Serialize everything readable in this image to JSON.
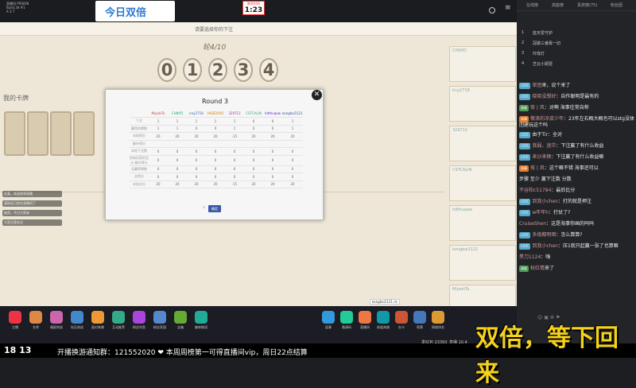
{
  "stream": {
    "title_lines": [
      "直播间 PRISON",
      "Build.3d #1",
      "X 3 T"
    ]
  },
  "banner": {
    "text": "今日双倍"
  },
  "timer": {
    "label": "剩余时间",
    "value": "1:23"
  },
  "game": {
    "hint": "请要选择你的下注",
    "round_label": "轮4/10",
    "digits": [
      "0",
      "1",
      "2",
      "3",
      "4"
    ],
    "my_cards_label": "我的卡牌"
  },
  "modal": {
    "title": "Round 3",
    "players": [
      "MiyakiTo",
      "CHNYD",
      "kny2718",
      "HAZEOOO",
      "329712",
      "CSTCALIN",
      "hdthuqaw",
      "kongbai1121"
    ],
    "rows": [
      {
        "label": "下注",
        "values": [
          "1",
          "1",
          "1",
          "1",
          "1",
          "0",
          "0",
          "1"
        ]
      },
      {
        "label": "赢得的牌数",
        "values": [
          "1",
          "1",
          "0",
          "0",
          "1",
          "0",
          "0",
          "1"
        ]
      },
      {
        "label": "本轮得分",
        "values": [
          "20",
          "20",
          "20",
          "20",
          "-15",
          "20",
          "20",
          "20"
        ]
      },
      {
        "label": "额外得分",
        "values": [
          "",
          "",
          "",
          "",
          "",
          "",
          "",
          ""
        ]
      },
      {
        "label": "本轮下注数",
        "values": [
          "0",
          "0",
          "0",
          "0",
          "0",
          "0",
          "0",
          "0"
        ]
      },
      {
        "label": "所有玩家的总分 额外得分",
        "values": [
          "0",
          "0",
          "0",
          "0",
          "0",
          "0",
          "0",
          "0"
        ]
      },
      {
        "label": "总赢得牌数",
        "values": [
          "0",
          "0",
          "0",
          "0",
          "0",
          "0",
          "0",
          "0"
        ]
      },
      {
        "label": "总得分",
        "values": [
          "0",
          "0",
          "0",
          "0",
          "0",
          "0",
          "0",
          "0"
        ]
      },
      {
        "label": "本轮总分",
        "values": [
          "20",
          "20",
          "20",
          "20",
          "-15",
          "20",
          "20",
          "20"
        ]
      }
    ],
    "confirm": "确定",
    "cancel_hint": "x"
  },
  "roster_names": [
    "CHNYD",
    "kny2718",
    "329712",
    "CSTCALIN",
    "hdthuqaw",
    "kongbai1121",
    "MiyakiTo"
  ],
  "footer_name": "kongbai1121 ck",
  "chat": {
    "tabs": [
      "在线榜",
      "高能榜",
      "贵宾榜(75)",
      "粉丝团"
    ],
    "rank": [
      {
        "n": "1",
        "name": "蓝天爱守护"
      },
      {
        "n": "2",
        "name": "冠歌三番靠一切"
      },
      {
        "n": "3",
        "name": "玲珑灯"
      },
      {
        "n": "4",
        "name": "芝云小斑斑"
      }
    ],
    "messages": [
      {
        "badge": "CSTC",
        "user": "草团",
        "text": "来，说个来了"
      },
      {
        "badge": "CSTC",
        "user": "晓晓没想好",
        "text": "：自作聪明是最有的"
      },
      {
        "badge": "高能",
        "user": "夜 | 风",
        "text": "：对啊 海事往常自称"
      },
      {
        "badge": "海事",
        "user": "傲浪的凉皮少年",
        "text": "：23年左右概大概也可以stg没体团建玩这个吗"
      },
      {
        "badge": "CSTC",
        "user": "",
        "text": "由于Tir：全对"
      },
      {
        "badge": "CSTC",
        "user": "我弱，迷茫",
        "text": "：下注赢了有什么收益"
      },
      {
        "badge": "CSTC",
        "user": "来沙来狮",
        "text": "：下注赢了有什么收益嘛"
      },
      {
        "badge": "海事",
        "user": "夜 | 风",
        "text": "：这个嘛不错 海事还可以"
      },
      {
        "badge": "",
        "user": "",
        "text": "步骤 至少 赢下注数 分数"
      },
      {
        "badge": "",
        "user": "不谷和c51784",
        "text": "：最后比分"
      },
      {
        "badge": "CSTC",
        "user": "到我小chen",
        "text": "：打的就是押注"
      },
      {
        "badge": "CSTC",
        "user": "w年年h",
        "text": "：打仗了?"
      },
      {
        "badge": "",
        "user": "CruiseShen",
        "text": "：这是海事你画的吗吗"
      },
      {
        "badge": "CSTC",
        "user": "多炮都明暗",
        "text": "：怎么算算?"
      },
      {
        "badge": "CSTC",
        "user": "到我小chen",
        "text": "：压1就只起赢一张了也算嘛"
      },
      {
        "badge": "",
        "user": "黑刀1124",
        "text": "：嗨"
      },
      {
        "badge": "高能",
        "user": "秋红倩",
        "text": "来了"
      }
    ]
  },
  "bottom_icons": [
    "主播",
    "名师",
    "福星热选",
    "钻石热选",
    "面对来袭",
    "互动推荐",
    "粉丝钓鱼",
    "粉丝家园",
    "宝箱",
    "森林物语",
    "居事",
    "邀请码",
    "直播间",
    "热道海滩",
    "办卡",
    "帮票",
    "网络排名"
  ],
  "stats": {
    "left": "发红包 23393",
    "right": "直播 10.4"
  },
  "ticker": {
    "clock": "18 13",
    "text": "开播换游通知群：121552020 ❤ 本周周榜第一可得直播间vip，周日22点结算"
  },
  "overlay_text": "双倍，等下回来",
  "left_chat": [
    "应某，欢迎来到直播",
    "某粉丝已经在直播间了",
    "抽奖，今日大家来",
    "大家注意安全"
  ],
  "colors": {
    "accent": "#2c78d4",
    "overlay": "#f5d21c"
  }
}
